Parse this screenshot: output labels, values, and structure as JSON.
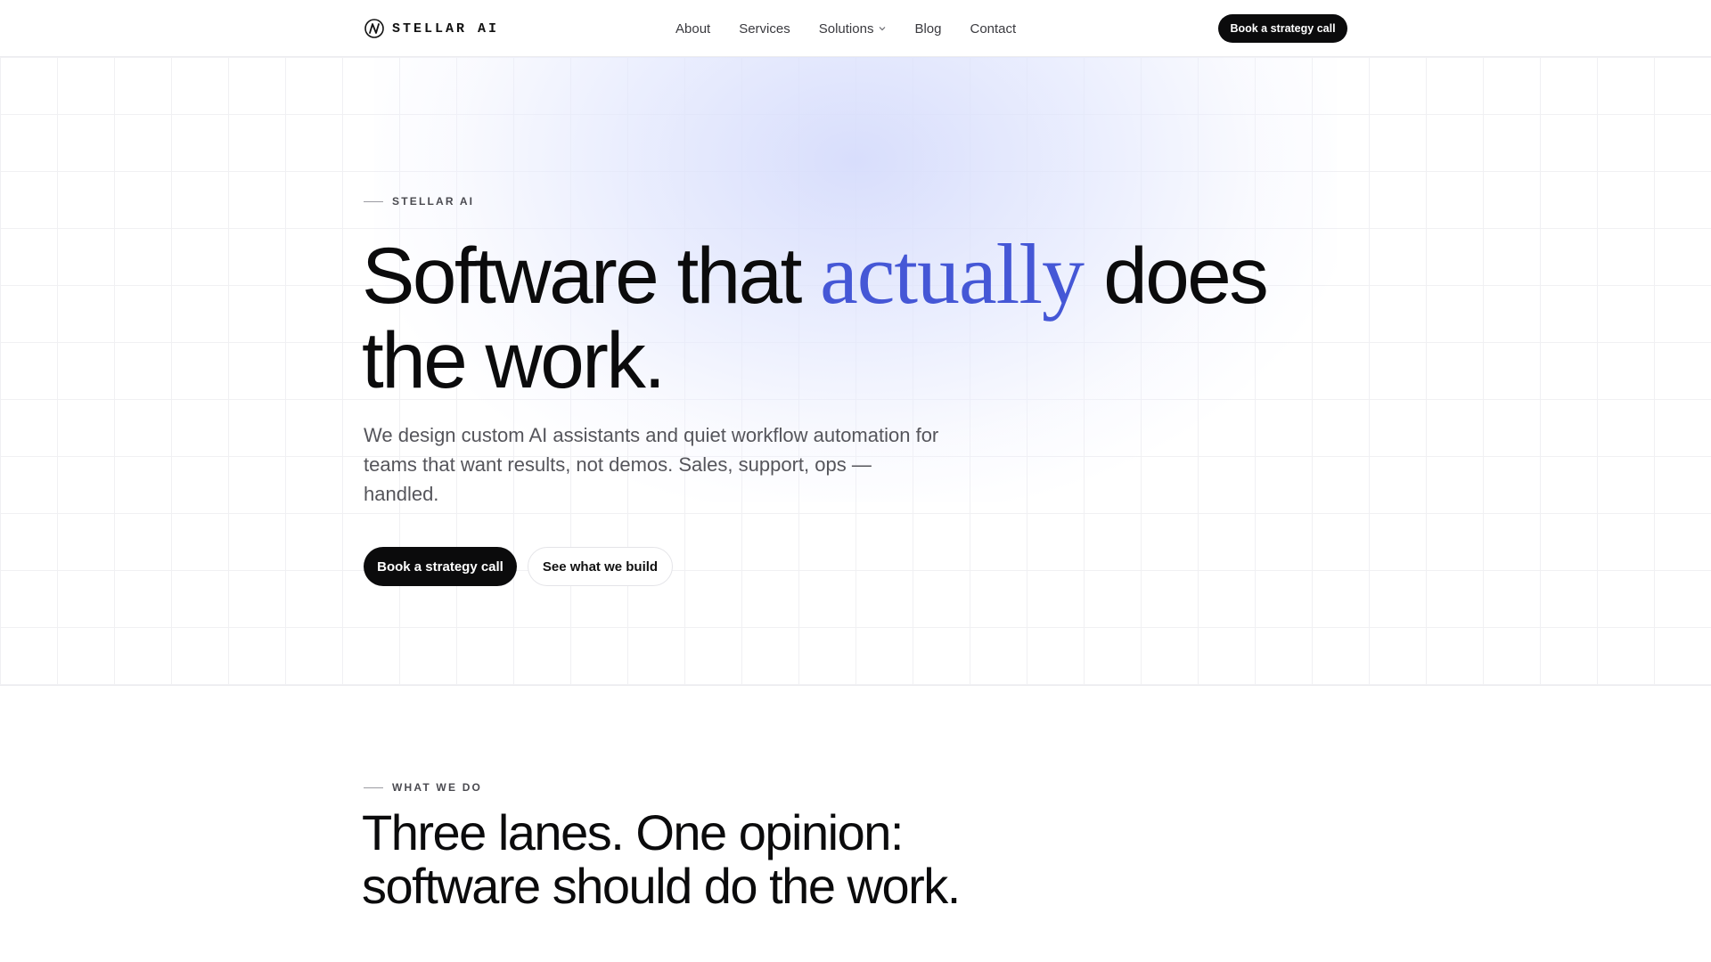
{
  "header": {
    "brand": {
      "text": "STELLAR AI",
      "icon": "stellar-logo-icon"
    },
    "nav": [
      {
        "label": "About"
      },
      {
        "label": "Services"
      },
      {
        "label": "Solutions",
        "icon": "chevron-down-icon"
      },
      {
        "label": "Blog"
      },
      {
        "label": "Contact"
      }
    ],
    "cta_label": "Book a strategy call"
  },
  "hero": {
    "eyebrow": "STELLAR AI",
    "title_before": "Software that",
    "title_accent": "actually",
    "title_after": "does the work.",
    "subtitle": "We design custom AI assistants and quiet workflow automation for teams that want results, not demos. Sales, support, ops — handled.",
    "primary_cta": "Book a strategy call",
    "secondary_cta": "See what we build"
  },
  "what_we_do": {
    "eyebrow": "WHAT WE DO",
    "title": "Three lanes. One opinion: software should do the work."
  },
  "colors": {
    "accent": "#4557d6",
    "primary_button": "#0b0b0c",
    "text": "#0b0b0c",
    "muted_text": "#55555b",
    "glow": "#dfe4fc"
  }
}
